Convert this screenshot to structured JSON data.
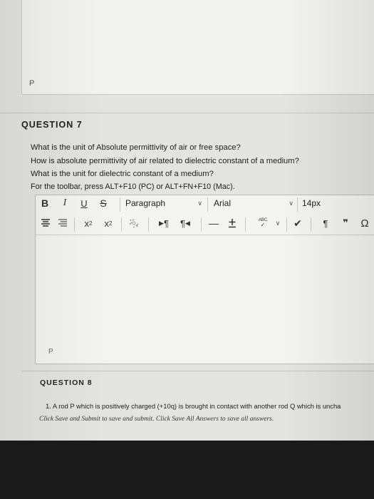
{
  "previous_editor": {
    "paragraph_tag": "P"
  },
  "question7": {
    "heading": "QUESTION 7",
    "lines": [
      "What is the unit of Absolute permittivity of air or free space?",
      "How is absolute permittivity of air related to dielectric constant of a medium?",
      "What is the unit for dielectric constant of a medium?",
      "For the toolbar, press ALT+F10 (PC) or ALT+FN+F10 (Mac)."
    ]
  },
  "toolbar": {
    "bold": "B",
    "italic": "I",
    "underline": "U",
    "strikethrough": "S",
    "format_value": "Paragraph",
    "font_value": "Arial",
    "size_value": "14px",
    "superscript_base": "x",
    "superscript_mark": "2",
    "subscript_base": "x",
    "subscript_mark": "2",
    "ltr_label": "¶",
    "rtl_label": "¶",
    "hr_label": "—",
    "spell_label": "ABC",
    "pilcrow": "¶",
    "quote": "❞",
    "omega": "Ω"
  },
  "editor": {
    "paragraph_tag": "P"
  },
  "question8": {
    "heading": "QUESTION 8",
    "text": "1. A rod P which is positively charged (+10q) is brought in contact with another rod Q which is uncha"
  },
  "footer_note": "Click Save and Submit to save and submit. Click Save All Answers to save all answers.",
  "icons": [
    "align-center-icon",
    "align-justify-icon",
    "unlink-icon",
    "text-direction-ltr-icon",
    "text-direction-rtl-icon",
    "horizontal-line-icon",
    "add-icon",
    "spellcheck-icon",
    "check-icon",
    "pilcrow-icon",
    "blockquote-icon",
    "special-char-icon"
  ]
}
